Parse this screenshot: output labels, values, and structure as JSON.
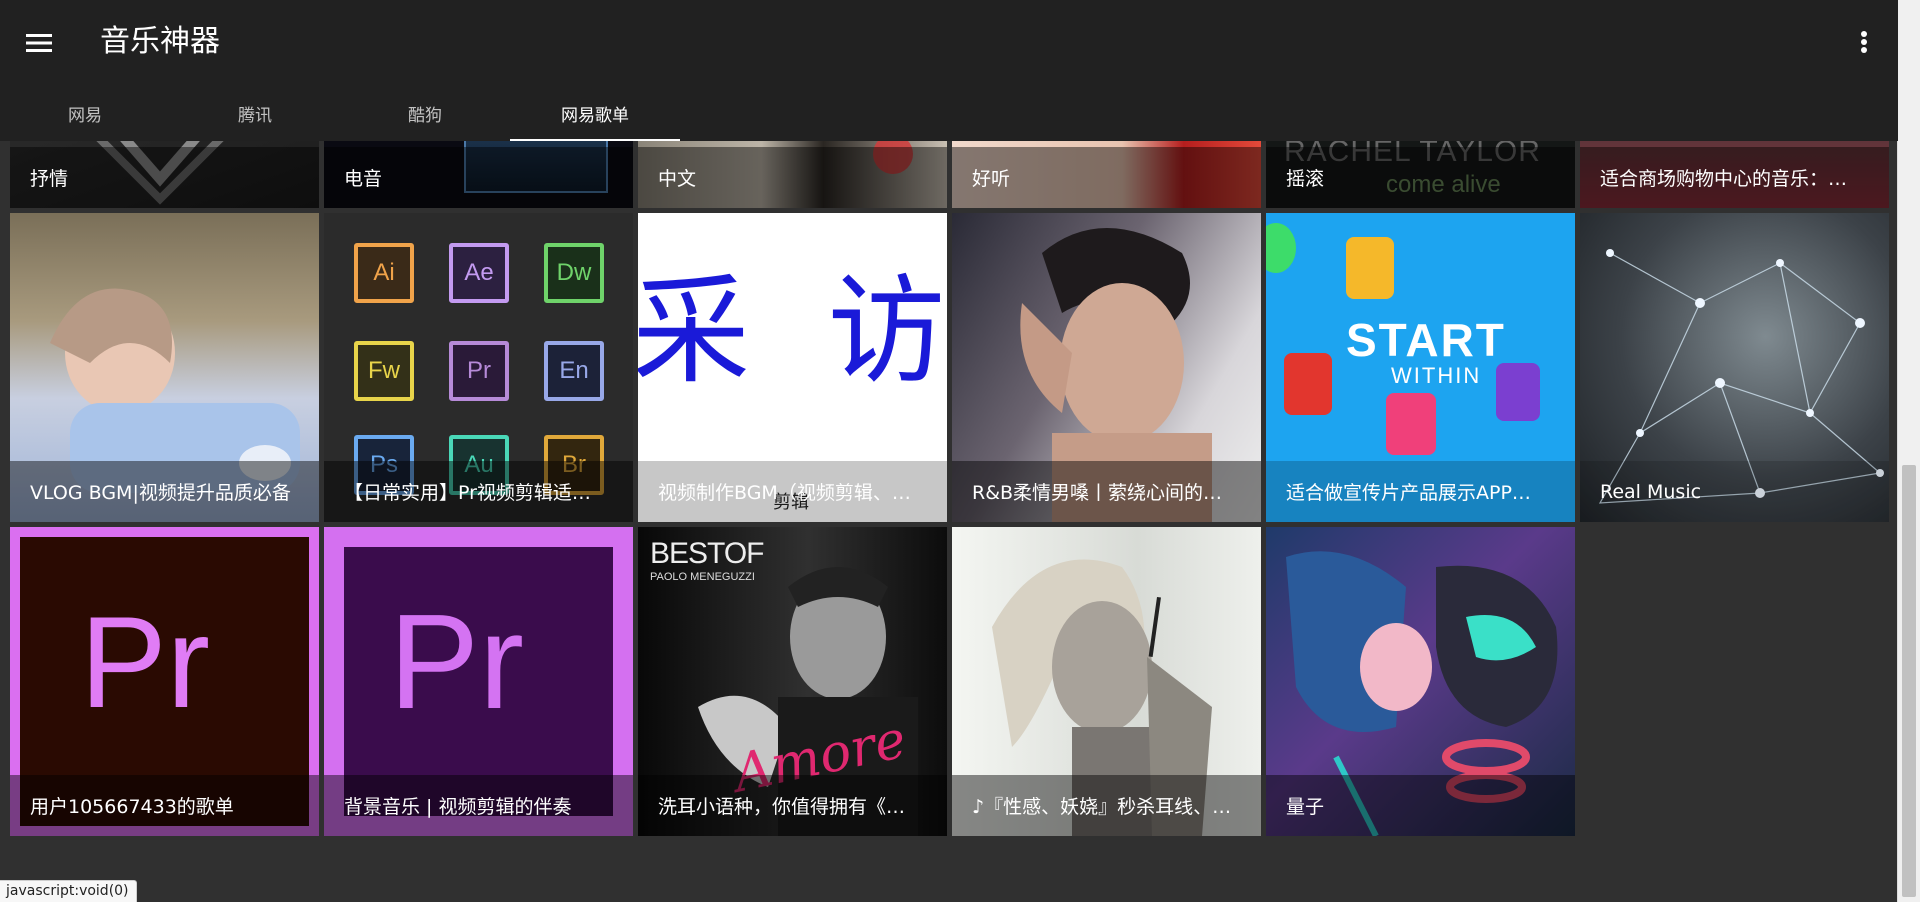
{
  "app": {
    "title": "音乐神器",
    "menu_icon": "hamburger-menu-icon",
    "more_icon": "more-vert-icon"
  },
  "tabs": [
    {
      "label": "网易"
    },
    {
      "label": "腾讯"
    },
    {
      "label": "酷狗"
    },
    {
      "label": "网易歌单",
      "active": true
    }
  ],
  "playlists_row1": [
    {
      "title": "抒情"
    },
    {
      "title": "电音"
    },
    {
      "title": "中文"
    },
    {
      "title": "好听"
    },
    {
      "title": "摇滚"
    },
    {
      "title": "适合商场购物中心的音乐：…"
    }
  ],
  "playlists_row2": [
    {
      "title": "VLOG BGM|视频提升品质必备"
    },
    {
      "title": "【日常实用】Pr视频剪辑适…"
    },
    {
      "title": "视频制作BGM（视频剪辑、…"
    },
    {
      "title": "R&B柔情男嗓丨萦绕心间的…"
    },
    {
      "title": "适合做宣传片产品展示APP…"
    },
    {
      "title": "Real Music"
    }
  ],
  "playlists_row3": [
    {
      "title": "用户105667433的歌单"
    },
    {
      "title": "背景音乐 | 视频剪辑的伴奏"
    },
    {
      "title": "洗耳小语种，你值得拥有《…"
    },
    {
      "title": "♪『性感、妖娆』秒杀耳线、…"
    },
    {
      "title": "量子"
    }
  ],
  "art_text": {
    "caifang": "采 访",
    "caifang_sub": "剪辑",
    "start": "START",
    "within": "WITHIN",
    "pr": "Pr",
    "bestof": "BESTOF",
    "meneguzzi": "PAOLO MENEGUZZI",
    "amore": "Amore",
    "rachel": "RACHEL TAYLOR",
    "come_alive": "come alive",
    "adobe_icons": [
      "Ai",
      "Ae",
      "Dw",
      "Fw",
      "Pr",
      "En",
      "Ps",
      "Au",
      "Br"
    ]
  },
  "status_bar": {
    "link": "javascript:void(0)"
  }
}
